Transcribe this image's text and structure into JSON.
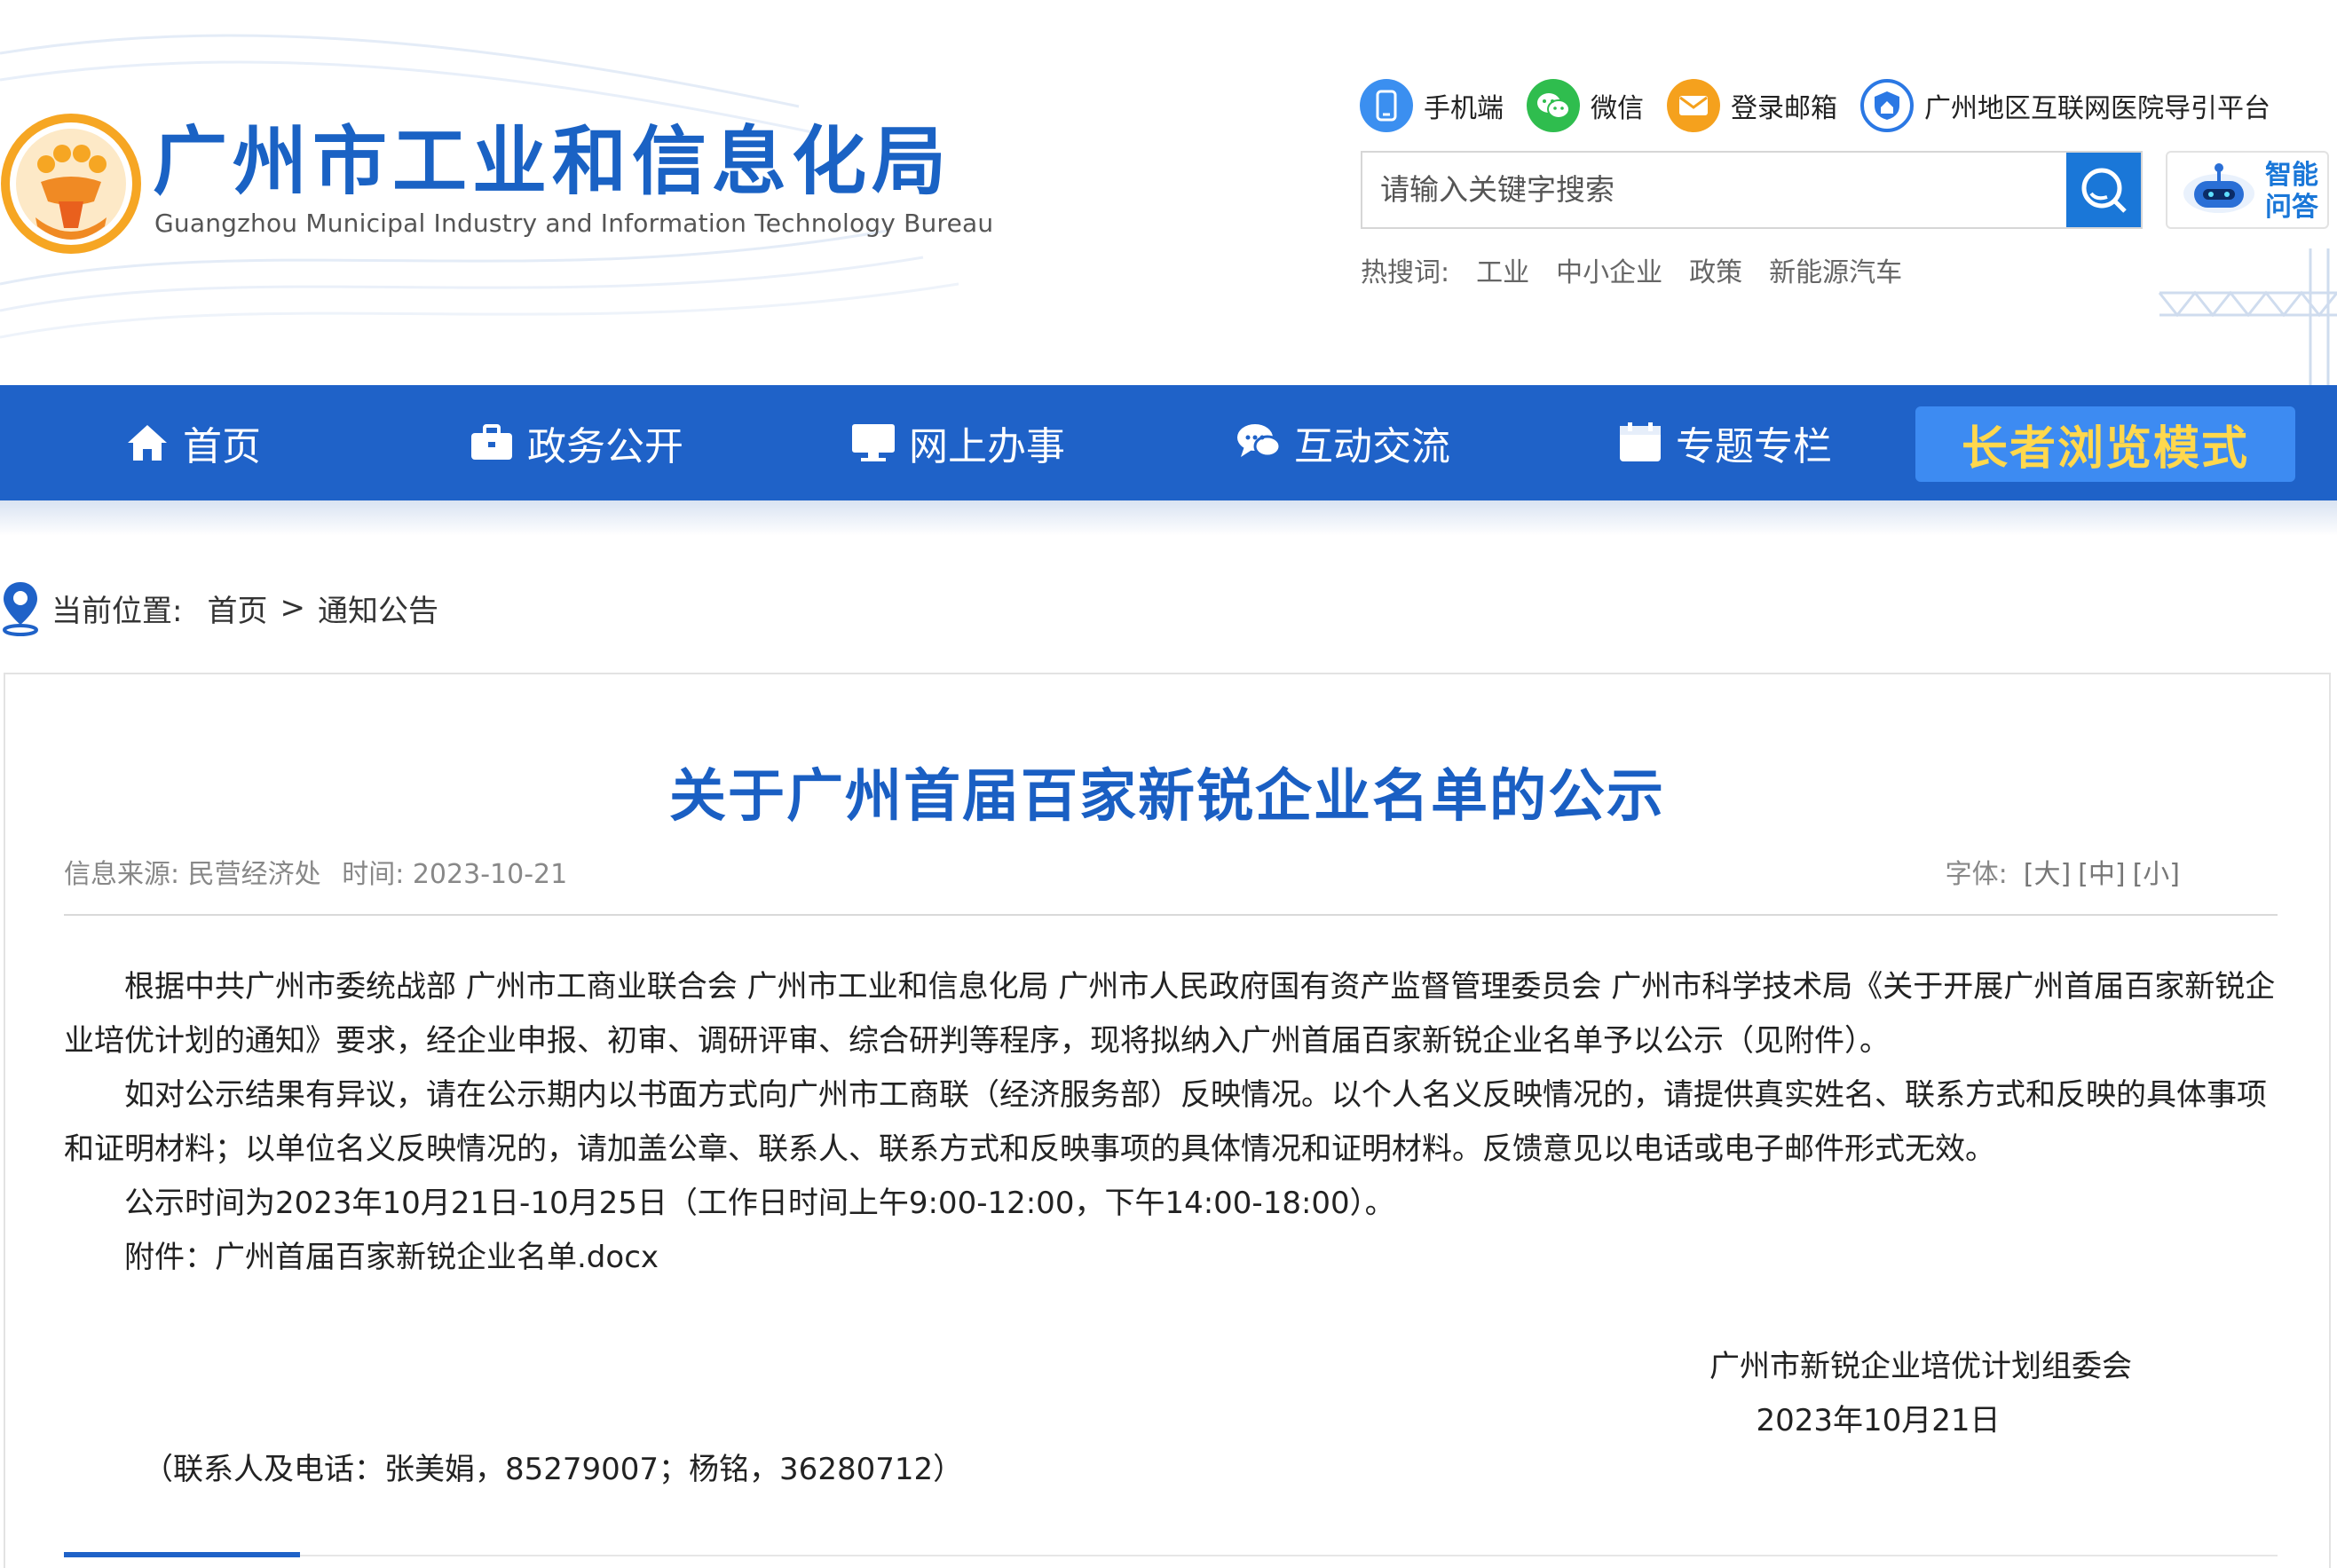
{
  "header": {
    "site_title": "广州市工业和信息化局",
    "site_subtitle": "Guangzhou Municipal Industry and Information Technology Bureau",
    "quick_links": [
      {
        "label": "手机端",
        "icon": "mobile-icon"
      },
      {
        "label": "微信",
        "icon": "wechat-icon"
      },
      {
        "label": "登录邮箱",
        "icon": "mail-icon"
      },
      {
        "label": "广州地区互联网医院导引平台",
        "icon": "hospital-shield-icon"
      }
    ],
    "search": {
      "placeholder": "请输入关键字搜索"
    },
    "ai_button": {
      "label": "智能问答",
      "icon": "robot-icon"
    },
    "hot_words": {
      "label": "热搜词:",
      "items": [
        "工业",
        "中小企业",
        "政策",
        "新能源汽车"
      ]
    }
  },
  "nav": {
    "items": [
      {
        "label": "首页",
        "icon": "home-icon"
      },
      {
        "label": "政务公开",
        "icon": "briefcase-icon"
      },
      {
        "label": "网上办事",
        "icon": "monitor-icon"
      },
      {
        "label": "互动交流",
        "icon": "chat-icon"
      },
      {
        "label": "专题专栏",
        "icon": "calendar-icon"
      }
    ],
    "elder_mode": "长者浏览模式"
  },
  "breadcrumb": {
    "label": "当前位置:",
    "items": [
      "首页",
      ">",
      "通知公告"
    ]
  },
  "article": {
    "title": "关于广州首届百家新锐企业名单的公示",
    "source": "信息来源: 民营经济处",
    "time": "时间: 2023-10-21",
    "font_size": {
      "label": "字体:",
      "large": "[大]",
      "medium": "[中]",
      "small": "[小]"
    },
    "paragraphs": [
      "根据中共广州市委统战部 广州市工商业联合会 广州市工业和信息化局 广州市人民政府国有资产监督管理委员会 广州市科学技术局《关于开展广州首届百家新锐企业培优计划的通知》要求，经企业申报、初审、调研评审、综合研判等程序，现将拟纳入广州首届百家新锐企业名单予以公示（见附件）。",
      "如对公示结果有异议，请在公示期内以书面方式向广州市工商联（经济服务部）反映情况。以个人名义反映情况的，请提供真实姓名、联系方式和反映的具体事项和证明材料；以单位名义反映情况的，请加盖公章、联系人、联系方式和反映事项的具体情况和证明材料。反馈意见以电话或电子邮件形式无效。",
      "公示时间为2023年10月21日-10月25日（工作日时间上午9:00-12:00，下午14:00-18:00）。"
    ],
    "attachment_label": "附件：",
    "attachment_name": "广州首届百家新锐企业名单.docx",
    "signature": "广州市新锐企业培优计划组委会",
    "signature_date": "2023年10月21日",
    "contact": "（联系人及电话：张美娟，85279007；杨铭，36280712）"
  }
}
